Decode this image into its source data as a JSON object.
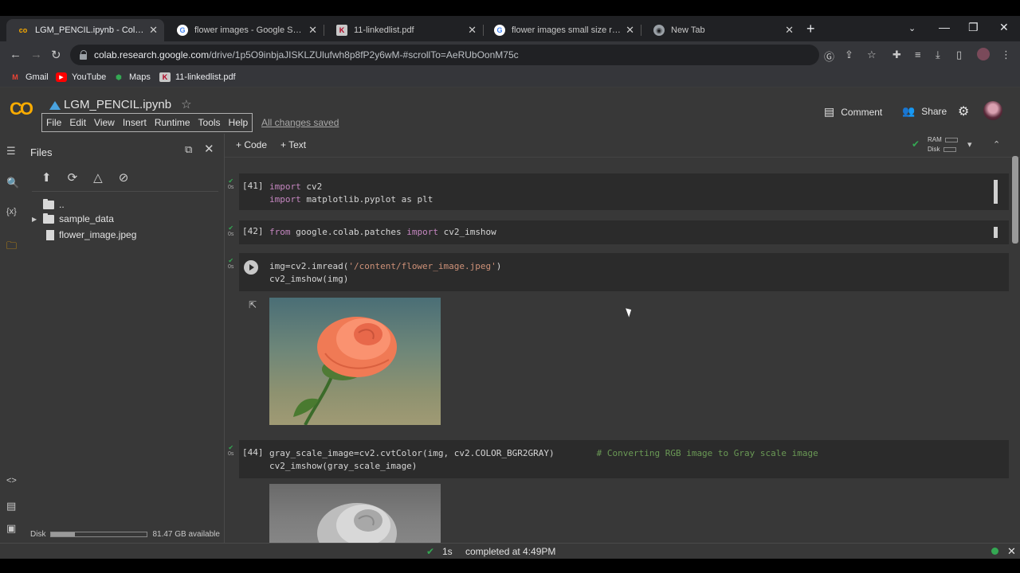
{
  "browser": {
    "tabs": [
      {
        "title": "LGM_PENCIL.ipynb - Colaboratory",
        "favicon": "colab-icon",
        "active": true
      },
      {
        "title": "flower images - Google Search",
        "favicon": "google-icon",
        "active": false
      },
      {
        "title": "11-linkedlist.pdf",
        "favicon": "pdf-icon",
        "active": false
      },
      {
        "title": "flower images small size rose - Google Search",
        "favicon": "google-icon",
        "active": false
      },
      {
        "title": "New Tab",
        "favicon": "chrome-icon",
        "active": false
      }
    ],
    "url_host": "colab.research.google.com",
    "url_path": "/drive/1p5O9inbjaJISKLZUlufwh8p8fP2y6wM-#scrollTo=AeRUbOonM75c",
    "bookmarks": [
      "Gmail",
      "YouTube",
      "Maps",
      "11-linkedlist.pdf"
    ]
  },
  "colab": {
    "notebook_title": "LGM_PENCIL.ipynb",
    "menu": [
      "File",
      "Edit",
      "View",
      "Insert",
      "Runtime",
      "Tools",
      "Help"
    ],
    "save_status": "All changes saved",
    "comment_label": "Comment",
    "share_label": "Share",
    "add_code_label": "+ Code",
    "add_text_label": "+ Text",
    "ram_label": "RAM",
    "disk_label": "Disk"
  },
  "files_panel": {
    "title": "Files",
    "items": [
      {
        "name": "..",
        "type": "folder-up"
      },
      {
        "name": "sample_data",
        "type": "folder"
      },
      {
        "name": "flower_image.jpeg",
        "type": "file"
      }
    ],
    "disk_label": "Disk",
    "disk_available": "81.47 GB available",
    "disk_used_fraction": 0.25
  },
  "cells": [
    {
      "exec": "[41]",
      "time": "0s",
      "lines": [
        "import cv2",
        "import matplotlib.pyplot as plt"
      ]
    },
    {
      "exec": "[42]",
      "time": "0s",
      "lines": [
        "from google.colab.patches import cv2_imshow"
      ]
    },
    {
      "exec": "",
      "time": "0s",
      "lines": [
        "img=cv2.imread('/content/flower_image.jpeg')",
        "cv2_imshow(img)"
      ]
    },
    {
      "exec": "[44]",
      "time": "0s",
      "lines": [
        "gray_scale_image=cv2.cvtColor(img, cv2.COLOR_BGR2GRAY)",
        "cv2_imshow(gray_scale_image)"
      ],
      "comment": "# Converting RGB image to Gray scale image"
    }
  ],
  "status_bar": {
    "duration": "1s",
    "message": "completed at 4:49PM"
  },
  "colors": {
    "accent_green": "#34a853",
    "colab_orange": "#f9ab00",
    "panel_bg": "#383838",
    "cell_bg": "#2b2b2b"
  }
}
